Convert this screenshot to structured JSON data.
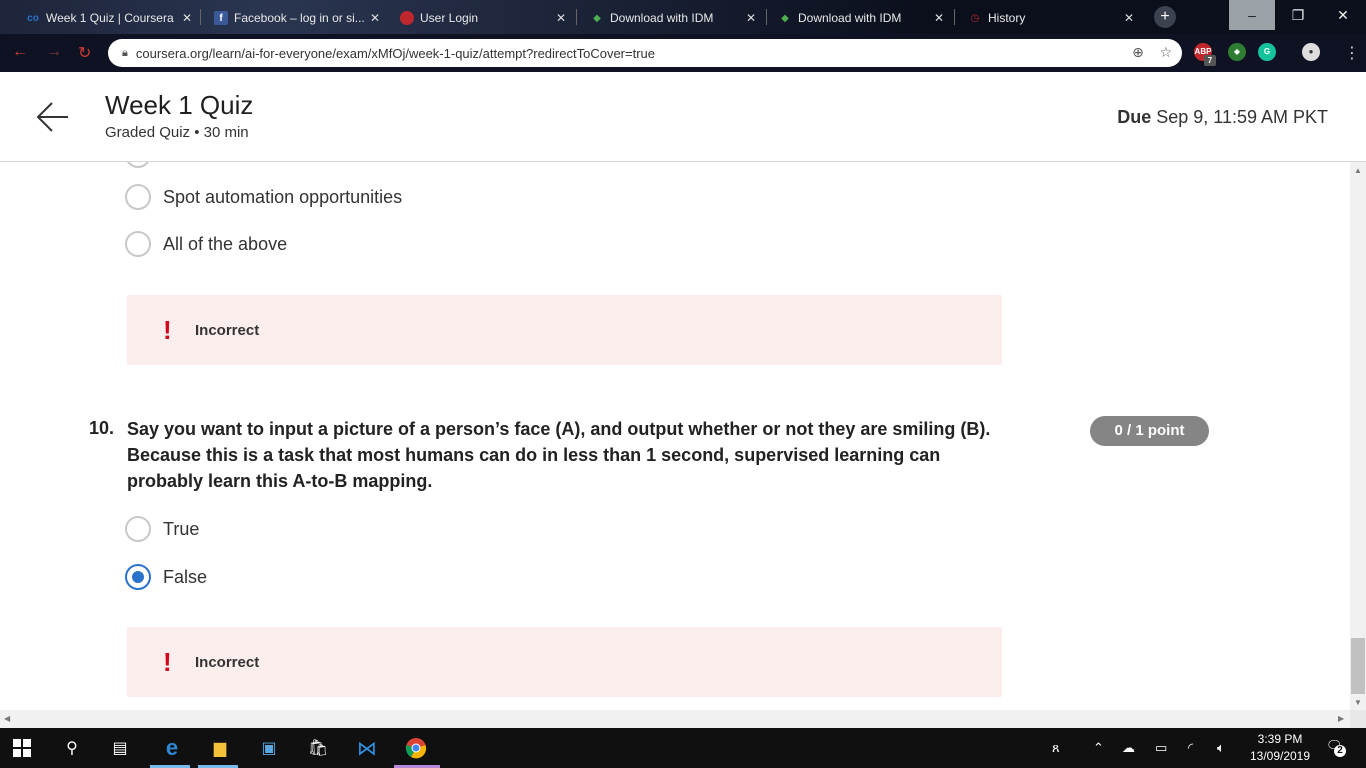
{
  "browser": {
    "tabs": [
      {
        "label": "Week 1 Quiz | Coursera",
        "icon": "coursera-icon"
      },
      {
        "label": "Facebook – log in or si...",
        "icon": "facebook-icon"
      },
      {
        "label": "User Login",
        "icon": "user-login-icon"
      },
      {
        "label": "Download with IDM",
        "icon": "idm-icon"
      },
      {
        "label": "Download with IDM",
        "icon": "idm-icon"
      },
      {
        "label": "History",
        "icon": "history-icon"
      }
    ],
    "url": "coursera.org/learn/ai-for-everyone/exam/xMfOj/week-1-quiz/attempt?redirectToCover=true",
    "ext_abp_badge": "7"
  },
  "header": {
    "title": "Week 1 Quiz",
    "subtitle": "Graded Quiz • 30 min",
    "due_label": "Due",
    "due_value": "Sep 9, 11:59 AM PKT"
  },
  "previous_question": {
    "options": [
      {
        "label": "Spot automation opportunities",
        "checked": false
      },
      {
        "label": "All of the above",
        "checked": false
      }
    ],
    "feedback": "Incorrect"
  },
  "question": {
    "number": "10.",
    "text": "Say you want to input a picture of a person’s face (A), and output whether or not they are smiling (B). Because this is a task that most humans can do in less than 1 second, supervised learning can probably learn this A-to-B mapping.",
    "points": "0 / 1 point",
    "options": [
      {
        "label": "True",
        "checked": false
      },
      {
        "label": "False",
        "checked": true
      }
    ],
    "feedback": "Incorrect"
  },
  "taskbar": {
    "time": "3:39 PM",
    "date": "13/09/2019",
    "notifications": "2"
  },
  "colors": {
    "accent": "#2a73cc",
    "incorrect_bg": "#fdeeee",
    "incorrect_mark": "#d1071c",
    "points_badge": "#858585"
  }
}
